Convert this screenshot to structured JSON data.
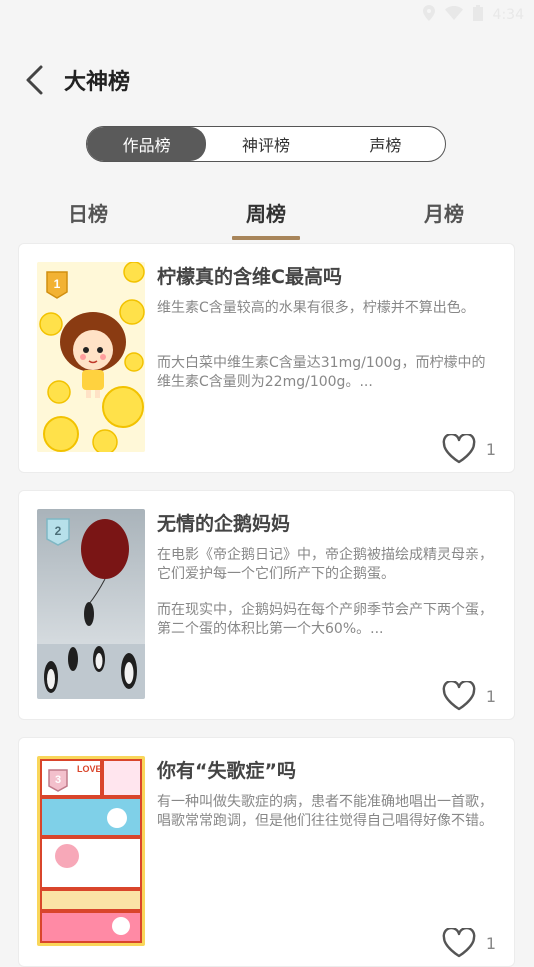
{
  "status_bar": {
    "time": "4:34"
  },
  "header": {
    "title": "大神榜"
  },
  "segments": [
    {
      "label": "作品榜",
      "active": true
    },
    {
      "label": "神评榜",
      "active": false
    },
    {
      "label": "声榜",
      "active": false
    }
  ],
  "period_tabs": [
    {
      "label": "日榜",
      "active": false
    },
    {
      "label": "周榜",
      "active": true
    },
    {
      "label": "月榜",
      "active": false
    }
  ],
  "posts": [
    {
      "rank": "1",
      "title": "柠檬真的含维C最高吗",
      "paragraph1": "维生素C含量较高的水果有很多，柠檬并不算出色。",
      "paragraph2": "而大白菜中维生素C含量达31mg/100g，而柠檬中的维生素C含量则为22mg/100g。...",
      "likes": "1"
    },
    {
      "rank": "2",
      "title": "无情的企鹅妈妈",
      "paragraph1": "在电影《帝企鹅日记》中，帝企鹅被描绘成精灵母亲，它们爱护每一个它们所产下的企鹅蛋。",
      "paragraph2": "而在现实中，企鹅妈妈在每个产卵季节会产下两个蛋，第二个蛋的体积比第一个大60%。...",
      "likes": "1"
    },
    {
      "rank": "3",
      "title": "你有“失歌症”吗",
      "paragraph1": "有一种叫做失歌症的病，患者不能准确地唱出一首歌，唱歌常常跑调，但是他们往往觉得自己唱得好像不错。",
      "paragraph2": "",
      "likes": "1",
      "thumb_text_love": "LOVE"
    }
  ],
  "colors": {
    "accent": "#a8855a",
    "segment_active": "#5a5a5a"
  }
}
